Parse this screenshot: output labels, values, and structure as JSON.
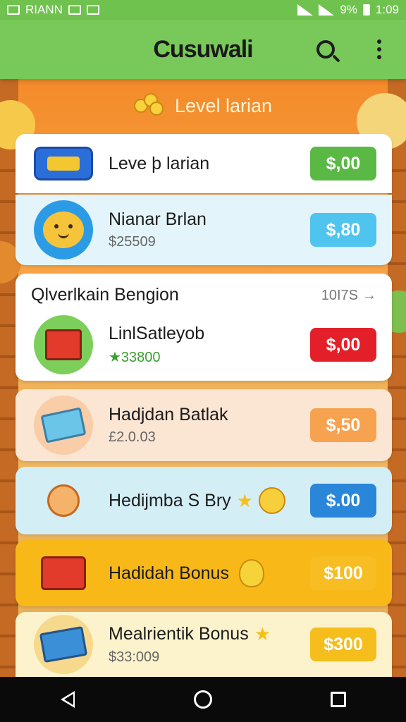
{
  "status_bar": {
    "carrier": "RIANN",
    "right_text": "9%",
    "time": "1:09"
  },
  "app": {
    "title": "Cusuwali"
  },
  "banner": {
    "title": "Level larian"
  },
  "items_top": [
    {
      "name": "Leve þ larian",
      "sub": "",
      "price": "$,00",
      "price_color": "#5ab945",
      "bg": "#ffffff",
      "icon": "game-controller-icon"
    },
    {
      "name": "Nianar Brlan",
      "sub": "$25509",
      "price": "$,80",
      "price_color": "#4fc4ef",
      "bg": "#e3f5fb",
      "icon": "bear-face-icon"
    }
  ],
  "section": {
    "title": "Qlverlkain Bengion",
    "link": "10I7S",
    "item": {
      "name": "LinlSatleyob",
      "sub": "★33800",
      "price": "$,00",
      "price_color": "#e3202a",
      "icon": "gift-book-icon"
    }
  },
  "items_bottom": [
    {
      "name": "Hadjdan Batlak",
      "sub": "£2.0.03",
      "price": "$,50",
      "price_color": "#f7a24e",
      "bg": "#fbe5d3",
      "icon": "card-arrow-icon"
    },
    {
      "name": "Hedijmba S Bry",
      "sub": "",
      "price": "$.00",
      "price_color": "#2a86d9",
      "bg": "#d4eef6",
      "icon": "kid-gift-icon"
    },
    {
      "name": "Hadidah Bonus",
      "sub": "",
      "price": "$100",
      "price_color": "#f7bd22",
      "bg": "#f8b818",
      "icon": "red-gift-icon"
    },
    {
      "name": "Mealrientik Bonus",
      "sub": "$33:009",
      "price": "$300",
      "price_color": "#f6be1c",
      "bg": "#fcf3cd",
      "icon": "treasure-map-icon"
    }
  ]
}
